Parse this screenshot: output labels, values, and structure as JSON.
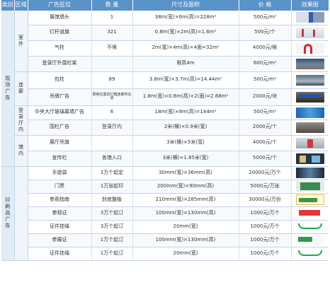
{
  "header": {
    "category": "类别",
    "area": "区域",
    "position": "广告区位",
    "quantity": "数 量",
    "size": "尺寸及面积",
    "price": "价 格",
    "preview": "效果图"
  },
  "groups": {
    "onsite": "现场广告",
    "print": "印刷品广告"
  },
  "areas": {
    "outdoor": "室外",
    "corridor": "连廊",
    "lobby": "登录厅内",
    "hall": "馆内"
  },
  "rows": [
    {
      "position": "展馆墙头",
      "quantity": "1",
      "size": "38m(宽)×6m(高)=228m²",
      "price": "500元/m²",
      "image": "building-facade-thumb"
    },
    {
      "position": "灯杆道旗",
      "quantity": "321",
      "size": "0.8m(宽)×2m(高)=1.6m²",
      "price": "500元/个",
      "image": "lamp-post-flag-thumb"
    },
    {
      "position": "气柱",
      "quantity": "不限",
      "size": "2m(宽)×4m(高)×4面=32m²",
      "price": "4000元/根",
      "image": "air-arch-thumb"
    },
    {
      "position": "登录厅外围栏架",
      "quantity": "",
      "size": "限高4m",
      "price": "600元/m²",
      "image": "registration-frame-thumb"
    },
    {
      "position": "包柱",
      "quantity": "89",
      "size": "3.8m(宽)×3.7m(高)=14.44m²",
      "price": "500元/m²",
      "image": "column-wrap-thumb"
    },
    {
      "position": "吊牌广告",
      "quantity": "限制位置的灯箱连廊所在道",
      "size": "1.8m(宽)×0.8m(高)×2(面)=2.88m²",
      "price": "2000元/块",
      "image": "hanging-sign-thumb"
    },
    {
      "position": "中央大厅玻璃幕墙广告",
      "quantity": "6",
      "size": "18m(宽)×8m(高)=144m²",
      "price": "500元/m²",
      "image": "glass-curtain-thumb"
    },
    {
      "position": "围栏广告",
      "quantity": "登录厅内",
      "size": "2米(横)×0.9米(宽)",
      "price": "2000元/个",
      "image": "fence-ad-thumb"
    },
    {
      "position": "展厅吊旗",
      "quantity": "",
      "size": "3米(横)×5米(宽)",
      "price": "4000元/个",
      "image": "hall-flag-thumb"
    },
    {
      "position": "宣传栏",
      "quantity": "各馆入口",
      "size": "3米(横)×1.85米(宽)",
      "price": "5000元/个",
      "image": "bulletin-board-thumb"
    },
    {
      "position": "手提袋",
      "quantity": "1万个起定",
      "size": "30mm(宽)×36mm(高)",
      "price": "20000元/万个",
      "image": "handbag-thumb"
    },
    {
      "position": "门票",
      "quantity": "1万张起印",
      "size": "200mm(宽)×90mm(高)",
      "price": "5000元/万张",
      "image": "ticket-thumb"
    },
    {
      "position": "参观指南",
      "quantity": "封底整版",
      "size": "210mm(宽)×285mm(高)",
      "price": "30000元/万份",
      "image": "visitor-guide-thumb"
    },
    {
      "position": "参观证",
      "quantity": "3万个起订",
      "size": "100mm(宽)×130mm(高)",
      "price": "1000元/万个",
      "image": "visitor-pass-thumb"
    },
    {
      "position": "证件挂绳",
      "quantity": "3万个起订",
      "size": "20mm(宽)",
      "price": "1000元/万个",
      "image": "lanyard-thumb"
    },
    {
      "position": "参展证",
      "quantity": "1万个起订",
      "size": "100mm(宽)×130mm(高)",
      "price": "1000元/万个",
      "image": "exhibitor-pass-thumb"
    },
    {
      "position": "证件挂绳",
      "quantity": "1万个起订",
      "size": "20mm(宽)",
      "price": "1000元/万个",
      "image": "lanyard-thumb"
    }
  ],
  "colors": {
    "header_bg": "#5a93c8",
    "category_bg": "#e1ecf6",
    "border": "#c3d3e6"
  }
}
